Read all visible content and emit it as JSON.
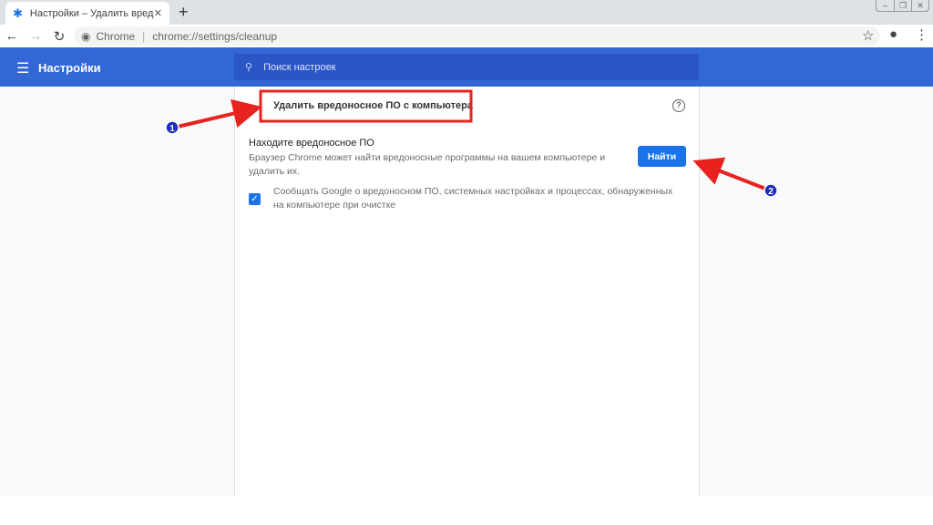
{
  "browser": {
    "tab_title": "Настройки – Удалить вредонос",
    "url_prefix": "Chrome",
    "url": "chrome://settings/cleanup",
    "url_host": "settings",
    "icons": [
      "gear-icon",
      "close-icon",
      "plus-icon",
      "back-icon",
      "forward-icon",
      "reload-icon",
      "star-icon",
      "account-icon",
      "more-icon"
    ]
  },
  "header": {
    "title": "Настройки",
    "search_placeholder": "Поиск настроек"
  },
  "page": {
    "title": "Удалить вредоносное ПО с компьютера",
    "section_title": "Находите вредоносное ПО",
    "section_desc": "Браузер Chrome может найти вредоносные программы на вашем компьютере и удалить их.",
    "find_button": "Найти",
    "checkbox_label": "Сообщать Google о вредоносном ПО, системных настройках и процессах, обнаруженных на компьютере при очистке",
    "checkbox_checked": true
  },
  "annotations": {
    "marker1": "1",
    "marker2": "2",
    "color": "#e8231f"
  },
  "colors": {
    "header": "#3367d6",
    "accent": "#1a73e8"
  }
}
